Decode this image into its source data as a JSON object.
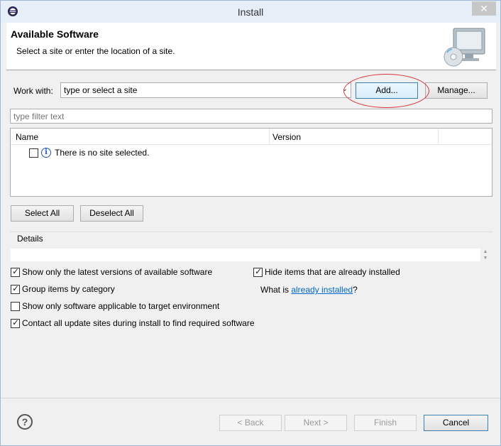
{
  "window": {
    "title": "Install",
    "close_symbol": "✕",
    "app_icon": "eclipse-icon"
  },
  "header": {
    "title": "Available Software",
    "description": "Select a site or enter the location of a site.",
    "icon": "install-cd-monitor-icon"
  },
  "work_with": {
    "label": "Work with:",
    "value": "type or select a site",
    "add_label": "Add...",
    "manage_label": "Manage..."
  },
  "filter": {
    "placeholder": "type filter text"
  },
  "table": {
    "columns": [
      "Name",
      "Version"
    ],
    "rows": [
      {
        "checked": false,
        "icon": "info-icon",
        "text": "There is no site selected."
      }
    ]
  },
  "selection": {
    "select_all": "Select All",
    "deselect_all": "Deselect All"
  },
  "details": {
    "label": "Details"
  },
  "options": {
    "show_latest": {
      "label": "Show only the latest versions of available software",
      "checked": true
    },
    "group_by_category": {
      "label": "Group items by category",
      "checked": true
    },
    "show_applicable": {
      "label": "Show only software applicable to target environment",
      "checked": false
    },
    "contact_all_sites": {
      "label": "Contact all update sites during install to find required software",
      "checked": true
    },
    "hide_installed": {
      "label": "Hide items that are already installed",
      "checked": true
    },
    "what_is_prefix": "What is ",
    "what_is_link": "already installed",
    "what_is_suffix": "?"
  },
  "footer": {
    "back": "< Back",
    "next": "Next >",
    "finish": "Finish",
    "cancel": "Cancel"
  },
  "colors": {
    "annotation_ellipse": "#d6343c",
    "link": "#0066cc"
  }
}
